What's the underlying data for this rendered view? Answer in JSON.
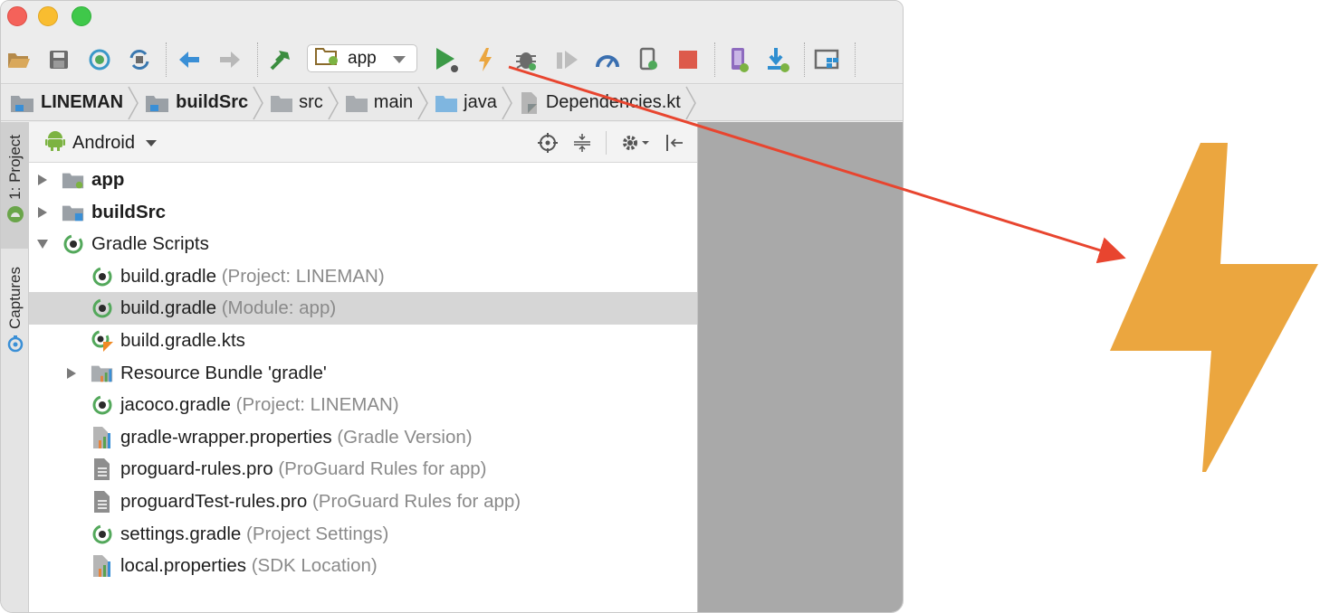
{
  "toolbar": {
    "buttons": [
      {
        "name": "open-icon"
      },
      {
        "name": "save-icon"
      },
      {
        "name": "sync-icon"
      },
      {
        "name": "sync-gradle-icon"
      },
      {
        "name": "back-icon"
      },
      {
        "name": "forward-icon"
      },
      {
        "name": "make-project-icon"
      },
      {
        "name": "run-icon"
      },
      {
        "name": "apply-changes-icon"
      },
      {
        "name": "debug-icon"
      },
      {
        "name": "coverage-icon"
      },
      {
        "name": "profile-icon"
      },
      {
        "name": "attach-debugger-icon"
      },
      {
        "name": "stop-icon"
      },
      {
        "name": "avd-manager-icon"
      },
      {
        "name": "sdk-manager-icon"
      },
      {
        "name": "project-structure-icon"
      }
    ],
    "run_config": {
      "value": "app"
    }
  },
  "breadcrumb": [
    {
      "label": "LINEMAN",
      "bold": true
    },
    {
      "label": "buildSrc",
      "bold": true
    },
    {
      "label": "src",
      "bold": false
    },
    {
      "label": "main",
      "bold": false
    },
    {
      "label": "java",
      "bold": false
    },
    {
      "label": "Dependencies.kt",
      "bold": false
    }
  ],
  "side_tabs": {
    "project": "1: Project",
    "captures": "Captures"
  },
  "project_panel": {
    "view_mode": "Android",
    "tree": [
      {
        "label": "app",
        "hint": "",
        "bold": true,
        "depth": 0,
        "expanded": false,
        "has_arrow": true,
        "icon": "module-folder-icon",
        "selected": false
      },
      {
        "label": "buildSrc",
        "hint": "",
        "bold": true,
        "depth": 0,
        "expanded": false,
        "has_arrow": true,
        "icon": "buildsrc-folder-icon",
        "selected": false
      },
      {
        "label": "Gradle Scripts",
        "hint": "",
        "bold": false,
        "depth": 0,
        "expanded": true,
        "has_arrow": true,
        "icon": "gradle-icon",
        "selected": false
      },
      {
        "label": "build.gradle",
        "hint": "(Project: LINEMAN)",
        "bold": false,
        "depth": 1,
        "has_arrow": false,
        "icon": "gradle-icon",
        "selected": false
      },
      {
        "label": "build.gradle",
        "hint": "(Module: app)",
        "bold": false,
        "depth": 1,
        "has_arrow": false,
        "icon": "gradle-icon",
        "selected": true
      },
      {
        "label": "build.gradle.kts",
        "hint": "",
        "bold": false,
        "depth": 1,
        "has_arrow": false,
        "icon": "gradle-kts-icon",
        "selected": false
      },
      {
        "label": "Resource Bundle 'gradle'",
        "hint": "",
        "bold": false,
        "depth": 1,
        "expanded": false,
        "has_arrow": true,
        "icon": "resource-bundle-icon",
        "selected": false
      },
      {
        "label": "jacoco.gradle",
        "hint": "(Project: LINEMAN)",
        "bold": false,
        "depth": 1,
        "has_arrow": false,
        "icon": "gradle-icon",
        "selected": false
      },
      {
        "label": "gradle-wrapper.properties",
        "hint": "(Gradle Version)",
        "bold": false,
        "depth": 1,
        "has_arrow": false,
        "icon": "properties-icon",
        "selected": false
      },
      {
        "label": "proguard-rules.pro",
        "hint": "(ProGuard Rules for app)",
        "bold": false,
        "depth": 1,
        "has_arrow": false,
        "icon": "text-file-icon",
        "selected": false
      },
      {
        "label": "proguardTest-rules.pro",
        "hint": "(ProGuard Rules for app)",
        "bold": false,
        "depth": 1,
        "has_arrow": false,
        "icon": "text-file-icon",
        "selected": false
      },
      {
        "label": "settings.gradle",
        "hint": "(Project Settings)",
        "bold": false,
        "depth": 1,
        "has_arrow": false,
        "icon": "gradle-icon",
        "selected": false
      },
      {
        "label": "local.properties",
        "hint": "(SDK Location)",
        "bold": false,
        "depth": 1,
        "has_arrow": false,
        "icon": "properties-icon",
        "selected": false
      }
    ]
  },
  "annotation": {
    "arrow_color": "#e8452f",
    "bolt_color": "#eba63f",
    "callout_icon": "apply-changes-icon"
  },
  "colors": {
    "run_green": "#3c9a47",
    "stop_red": "#dd5a4b",
    "gradle_green": "#53a85b",
    "folder_gray": "#9aa0a6",
    "selection": "#d6d6d6"
  }
}
